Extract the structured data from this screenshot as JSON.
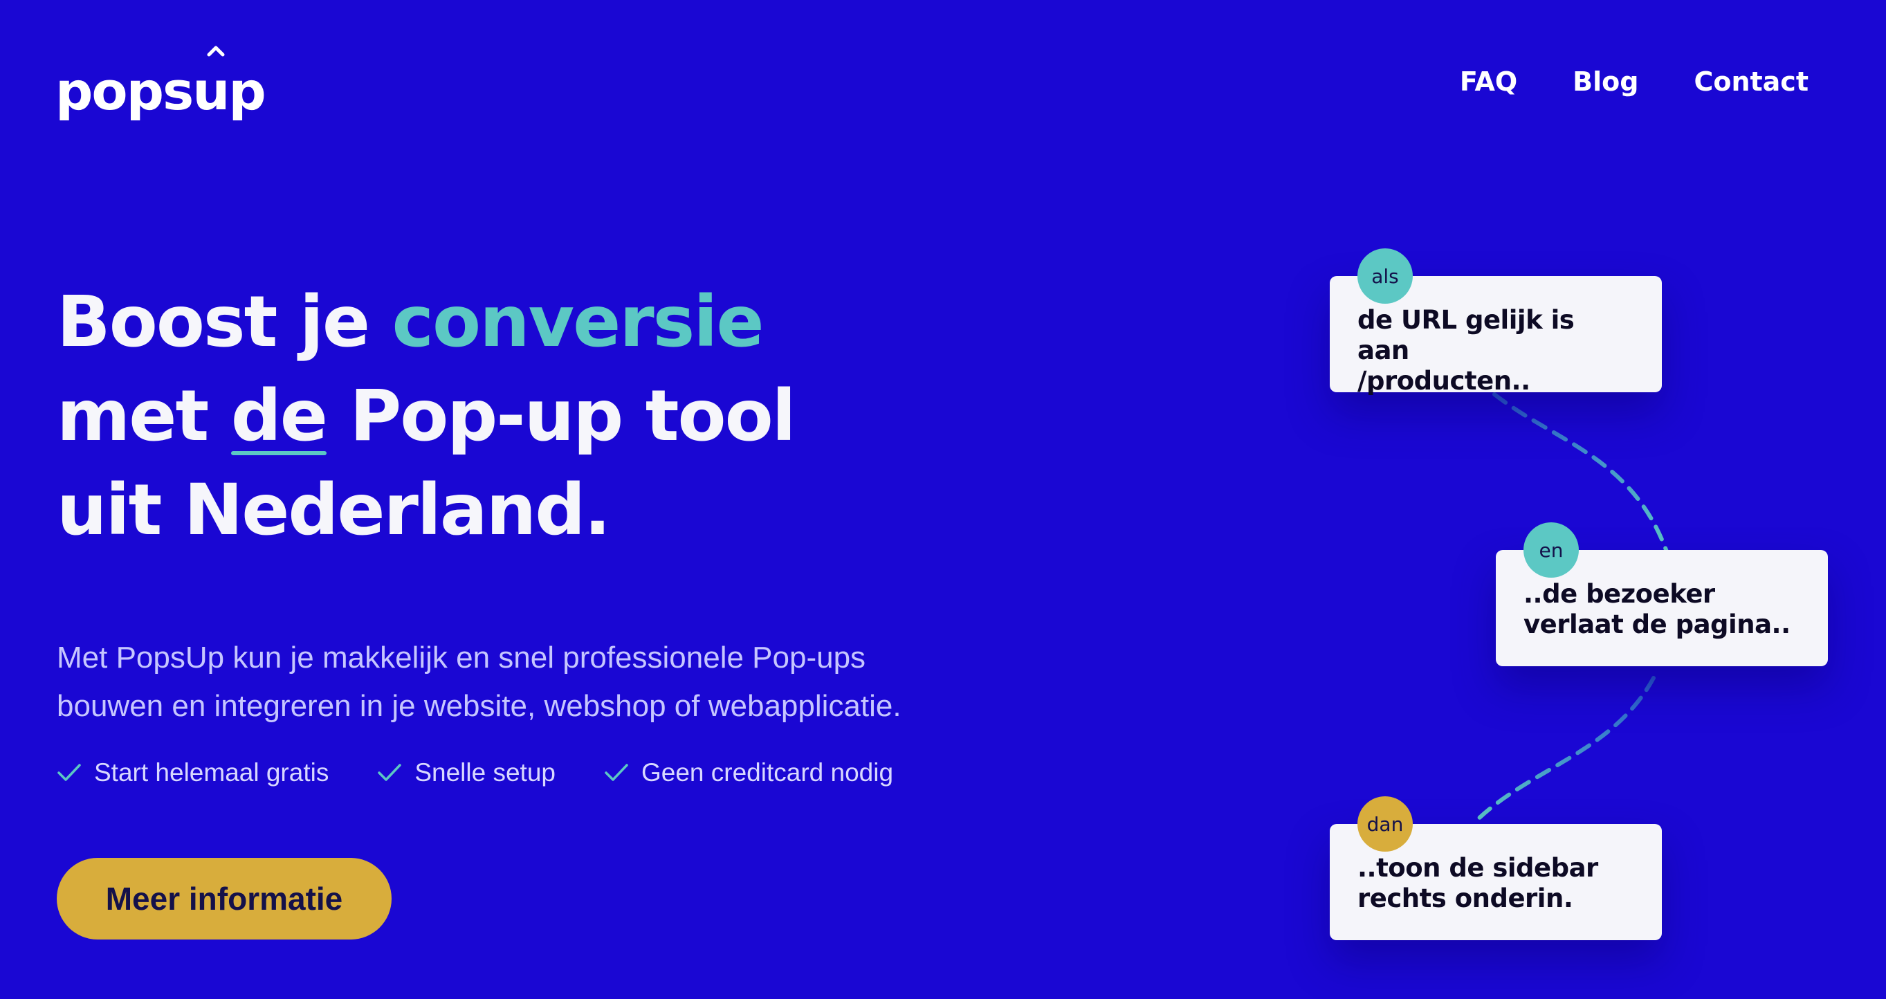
{
  "header": {
    "logo_text": "popsup",
    "nav": [
      "FAQ",
      "Blog",
      "Contact"
    ]
  },
  "hero": {
    "headline": {
      "line1_prefix": "Boost je ",
      "line1_accent": "conversie",
      "line2_prefix": "met ",
      "line2_underlined": "de",
      "line2_suffix": " Pop-up tool",
      "line3": "uit Nederland."
    },
    "subtitle_line1": "Met PopsUp kun je makkelijk en snel professionele Pop-ups",
    "subtitle_line2": "bouwen en integreren in je website, webshop of webapplicatie.",
    "checks": [
      "Start helemaal gratis",
      "Snelle setup",
      "Geen creditcard nodig"
    ],
    "cta_label": "Meer informatie"
  },
  "flow": {
    "steps": [
      {
        "badge": "als",
        "line1": "de URL gelijk is aan",
        "line2": "/producten..",
        "badge_color": "#5cc8c4"
      },
      {
        "badge": "en",
        "line1": "..de bezoeker",
        "line2": "verlaat de pagina..",
        "badge_color": "#5cc8c4"
      },
      {
        "badge": "dan",
        "line1": "..toon de sidebar",
        "line2": "rechts onderin.",
        "badge_color": "#d8ad3c"
      }
    ]
  },
  "colors": {
    "background": "#1a07d3",
    "accent_teal": "#5cc8c4",
    "accent_gold": "#d8ad3c",
    "card": "#f5f5fa"
  }
}
